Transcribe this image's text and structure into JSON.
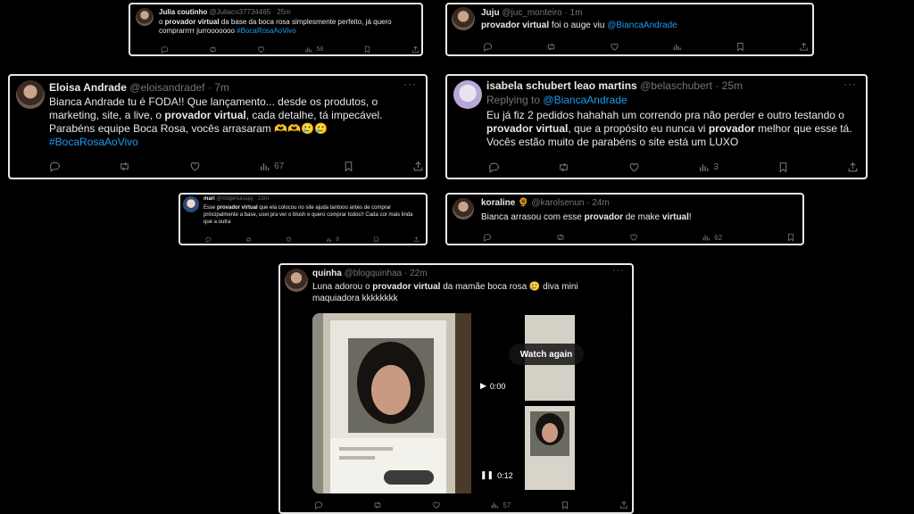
{
  "tweets": {
    "t1": {
      "name": "Julia coutinho",
      "handle": "@Juliaco37734465",
      "time": "25m",
      "body_pre": "o ",
      "body_bold": "provador virtual",
      "body_post": " da base da boca rosa simplesmente perfeito, já quero comprarrrrr jurrooooooo ",
      "hashtag": "#BocaRosaAoVivo",
      "views": "58"
    },
    "t2": {
      "name": "Juju",
      "handle": "@juc_monteiro",
      "time": "1m",
      "body_bold": "provador virtual",
      "body_post": " foi o auge viu ",
      "mention": "@BiancaAndrade"
    },
    "t3": {
      "name": "Eloisa Andrade",
      "handle": "@eloisandradef",
      "time": "7m",
      "body_pre": "Bianca Andrade tu é FODA!! Que lançamento... desde os produtos, o marketing, site, a live, o ",
      "body_bold": "provador virtual",
      "body_post": ", cada detalhe, tá impecável. Parabéns equipe Boca Rosa, vocês arrasaram 🫶🫶🥲🥲",
      "hashtag": "#BocaRosaAoVivo",
      "views": "67"
    },
    "t4": {
      "name": "isabela schubert leao martins",
      "handle": "@belaschubert",
      "time": "25m",
      "replying_prefix": "Replying to",
      "replying_to": "@BiancaAndrade",
      "body_pre": "Eu já fiz 2 pedidos hahahah um correndo pra não perder e outro testando o ",
      "body_bold": "provador virtual",
      "body_mid": ", que a propósito eu nunca vi ",
      "body_bold2": "provador",
      "body_post": " melhor que esse tá. Vocês estão muito de parabéns o site está um LUXO",
      "views": "3"
    },
    "t5": {
      "name": "mari",
      "handle": "@mdgenuisspy",
      "time": "23m",
      "body_pre": "Esse ",
      "body_bold": "provador virtual",
      "body_post": " que ela colocou no site ajuda tantooo antes de comprar principalmente a base, usei pra ver o blush e quero comprar todos!! Cada cor mais linda que a outra",
      "views": "9"
    },
    "t6": {
      "name": "koraline 🌻",
      "handle": "@karolsenun",
      "time": "24m",
      "body_pre": "Bianca arrasou com esse ",
      "body_bold": "provador",
      "body_mid": " de make ",
      "body_bold2": "virtual",
      "body_post": "!",
      "views": "62"
    },
    "t7": {
      "name": "quinha",
      "handle": "@blogquinhaa",
      "time": "22m",
      "body_pre": "Luna adorou o ",
      "body_bold": "provador virtual",
      "body_post": " da mamãe boca rosa 🥲 diva mini maquiadora kkkkkkkk",
      "watch_again": "Watch again",
      "time_a": "0:00",
      "time_b": "0:12",
      "views": "57"
    }
  },
  "colors": {
    "link": "#1d9bf0",
    "muted": "#71767b",
    "text": "#e7e9ea",
    "bg": "#000000"
  }
}
